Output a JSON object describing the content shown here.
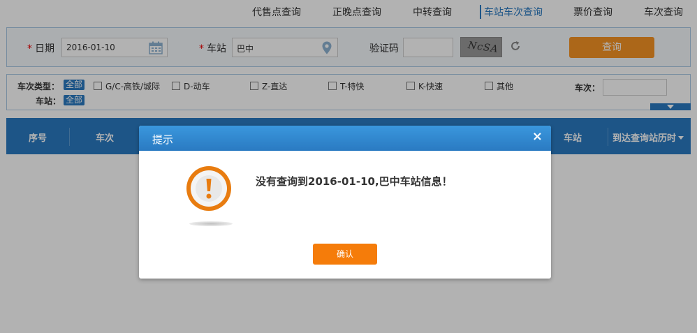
{
  "nav": {
    "items": [
      "代售点查询",
      "正晚点查询",
      "中转查询",
      "车站车次查询",
      "票价查询",
      "车次查询"
    ],
    "active_index": 3
  },
  "search": {
    "date_label": "日期",
    "date_value": "2016-01-10",
    "station_label": "车站",
    "station_value": "巴中",
    "captcha_label": "验证码",
    "captcha_value": "",
    "captcha_text": "NcSA",
    "required_mark": "*",
    "query_button": "查询"
  },
  "filters": {
    "train_type_label": "车次类型：",
    "station_label": "车站：",
    "all_tag": "全部",
    "types": [
      "G/C-高铁/城际",
      "D-动车",
      "Z-直达",
      "T-特快",
      "K-快速",
      "其他"
    ],
    "train_no_label": "车次：",
    "train_no_value": ""
  },
  "table": {
    "headers": [
      "序号",
      "车次",
      "车站",
      "到达查询站历时"
    ]
  },
  "modal": {
    "title": "提示",
    "close": "×",
    "message": "没有查询到2016-01-10,巴中车站信息！",
    "ok_button": "确认"
  },
  "colors": {
    "accent": "#2a7ac2",
    "query_button": "#f79424",
    "ok_button": "#f57c0a",
    "warning_icon": "#e87c10"
  }
}
